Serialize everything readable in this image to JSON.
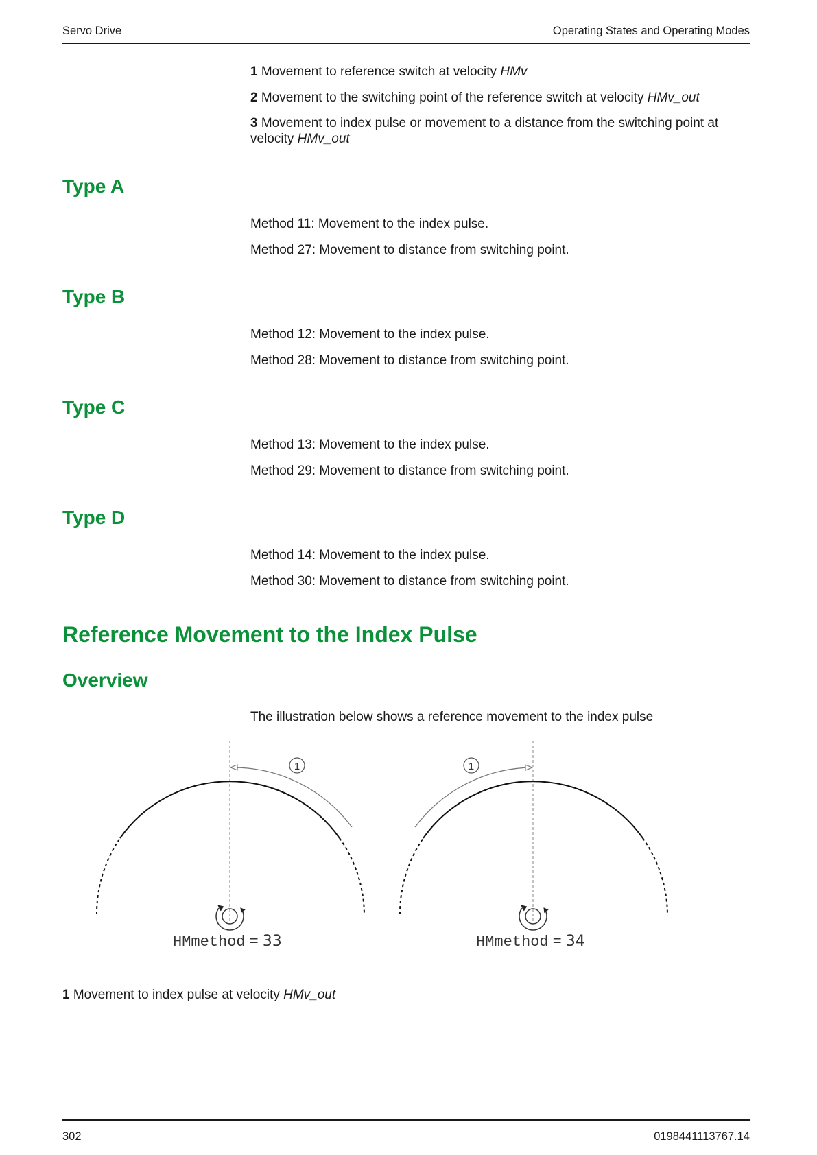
{
  "header": {
    "left": "Servo Drive",
    "right": "Operating States and Operating Modes"
  },
  "legend_top": [
    {
      "num": "1",
      "text": "Movement to reference switch at velocity ",
      "italic": "HMv"
    },
    {
      "num": "2",
      "text": "Movement to the switching point of the reference switch at velocity ",
      "italic": "HMv_out"
    },
    {
      "num": "3",
      "text": "Movement to index pulse or movement to a distance from the switching point at velocity ",
      "italic": "HMv_out"
    }
  ],
  "types": [
    {
      "heading": "Type A",
      "lines": [
        "Method 11: Movement to the index pulse.",
        "Method 27: Movement to distance from switching point."
      ]
    },
    {
      "heading": "Type B",
      "lines": [
        "Method 12: Movement to the index pulse.",
        "Method 28: Movement to distance from switching point."
      ]
    },
    {
      "heading": "Type C",
      "lines": [
        "Method 13: Movement to the index pulse.",
        "Method 29: Movement to distance from switching point."
      ]
    },
    {
      "heading": "Type D",
      "lines": [
        "Method 14: Movement to the index pulse.",
        "Method 30: Movement to distance from switching point."
      ]
    }
  ],
  "section_title": "Reference Movement to the Index Pulse",
  "subsection_title": "Overview",
  "intro": "The illustration below shows a reference movement to the index pulse",
  "figure": {
    "callout": "1",
    "left": {
      "param": "HMmethod",
      "eq": " = ",
      "value": "33"
    },
    "right": {
      "param": "HMmethod",
      "eq": " = ",
      "value": "34"
    }
  },
  "caption": {
    "num": "1",
    "text": "Movement to index pulse at velocity ",
    "italic": "HMv_out"
  },
  "footer": {
    "page": "302",
    "doc_id": "0198441113767.14"
  }
}
